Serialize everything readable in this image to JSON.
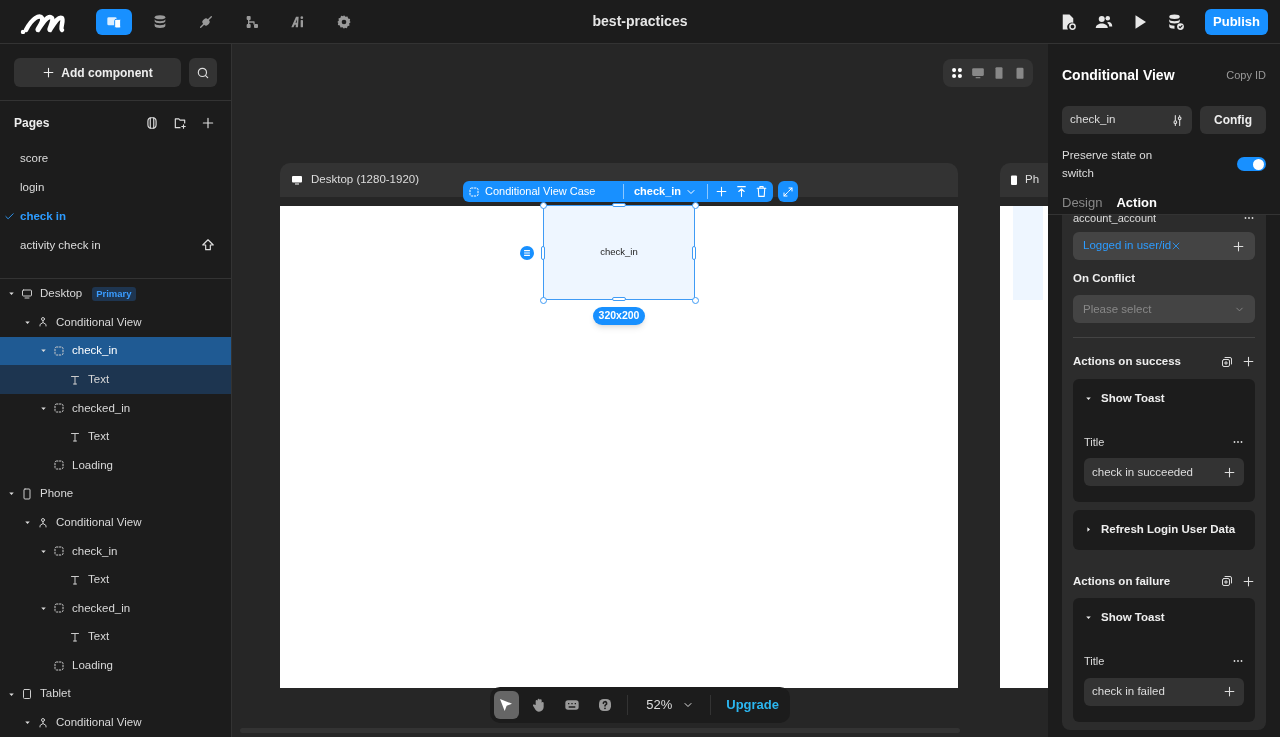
{
  "top_nav": {
    "modes": [
      {
        "kind": "pages",
        "selected": true
      },
      {
        "kind": "data",
        "selected": false
      },
      {
        "kind": "api",
        "selected": false
      },
      {
        "kind": "flow",
        "selected": false
      },
      {
        "kind": "ai",
        "selected": false
      },
      {
        "kind": "settings",
        "selected": false
      }
    ],
    "project_title": "best-practices",
    "actions": [
      {
        "kind": "page-settings"
      },
      {
        "kind": "users"
      },
      {
        "kind": "preview"
      },
      {
        "kind": "database-check"
      }
    ],
    "publish": "Publish"
  },
  "sidebar": {
    "add_component": "Add component",
    "pages": {
      "title": "Pages",
      "items": [
        {
          "label": "score",
          "selected": false,
          "home": false
        },
        {
          "label": "login",
          "selected": false,
          "home": false
        },
        {
          "label": "check in",
          "selected": true,
          "home": false
        },
        {
          "label": "activity check in",
          "selected": false,
          "home": true
        }
      ]
    },
    "tree": [
      {
        "label": "Desktop",
        "kind": "desktop",
        "badge": "Primary",
        "selected": false,
        "children": [
          {
            "label": "Conditional View",
            "kind": "conditional",
            "selected": false,
            "children": [
              {
                "label": "check_in",
                "kind": "case",
                "selected": true,
                "children": [
                  {
                    "label": "Text",
                    "kind": "text",
                    "selected": false
                  }
                ]
              },
              {
                "label": "checked_in",
                "kind": "case",
                "selected": false,
                "children": [
                  {
                    "label": "Text",
                    "kind": "text",
                    "selected": false
                  }
                ]
              },
              {
                "label": "Loading",
                "kind": "case",
                "selected": false
              }
            ]
          }
        ]
      },
      {
        "label": "Phone",
        "kind": "phone",
        "selected": false,
        "children": [
          {
            "label": "Conditional View",
            "kind": "conditional",
            "selected": false,
            "children": [
              {
                "label": "check_in",
                "kind": "case",
                "selected": false,
                "children": [
                  {
                    "label": "Text",
                    "kind": "text",
                    "selected": false
                  }
                ]
              },
              {
                "label": "checked_in",
                "kind": "case",
                "selected": false,
                "children": [
                  {
                    "label": "Text",
                    "kind": "text",
                    "selected": false
                  }
                ]
              },
              {
                "label": "Loading",
                "kind": "case",
                "selected": false
              }
            ]
          }
        ]
      },
      {
        "label": "Tablet",
        "kind": "tablet",
        "selected": false,
        "expanded": true,
        "children": [
          {
            "label": "Conditional View",
            "kind": "conditional",
            "selected": false,
            "expanded": true
          }
        ]
      }
    ]
  },
  "canvas": {
    "view_switcher": [
      {
        "kind": "all",
        "selected": true
      },
      {
        "kind": "desktop",
        "selected": false
      },
      {
        "kind": "tablet",
        "selected": false
      },
      {
        "kind": "phone",
        "selected": false
      }
    ],
    "frames": [
      {
        "kind": "desktop",
        "label": "Desktop (1280-1920)"
      },
      {
        "kind": "phone",
        "label": "Ph"
      }
    ],
    "selection": {
      "type_label": "Conditional View Case",
      "case": "check_in",
      "content": "check_in",
      "size": "320x200"
    },
    "tools": [
      {
        "kind": "select",
        "selected": true
      },
      {
        "kind": "hand",
        "selected": false
      },
      {
        "kind": "keyboard",
        "selected": false
      },
      {
        "kind": "help",
        "selected": false
      }
    ],
    "zoom": "52%",
    "upgrade": "Upgrade"
  },
  "inspector": {
    "title": "Conditional View",
    "copy_id": "Copy ID",
    "state_value": "check_in",
    "config": "Config",
    "preserve_label": "Preserve state on switch",
    "preserve_on": true,
    "tabs": [
      {
        "label": "Design",
        "selected": false
      },
      {
        "label": "Action",
        "selected": true
      }
    ],
    "param_label": "account_account",
    "param_value": "Logged in user/id",
    "conflict_label": "On Conflict",
    "conflict_placeholder": "Please select",
    "sections": [
      {
        "title": "Actions on success",
        "actions": [
          {
            "name": "Show Toast",
            "expanded": true,
            "fields": [
              {
                "label": "Title",
                "value": "check in succeeded"
              }
            ]
          },
          {
            "name": "Refresh Login User Data",
            "expanded": false
          }
        ]
      },
      {
        "title": "Actions on failure",
        "actions": [
          {
            "name": "Show Toast",
            "expanded": true,
            "fields": [
              {
                "label": "Title",
                "value": "check in failed"
              }
            ]
          }
        ]
      }
    ]
  }
}
